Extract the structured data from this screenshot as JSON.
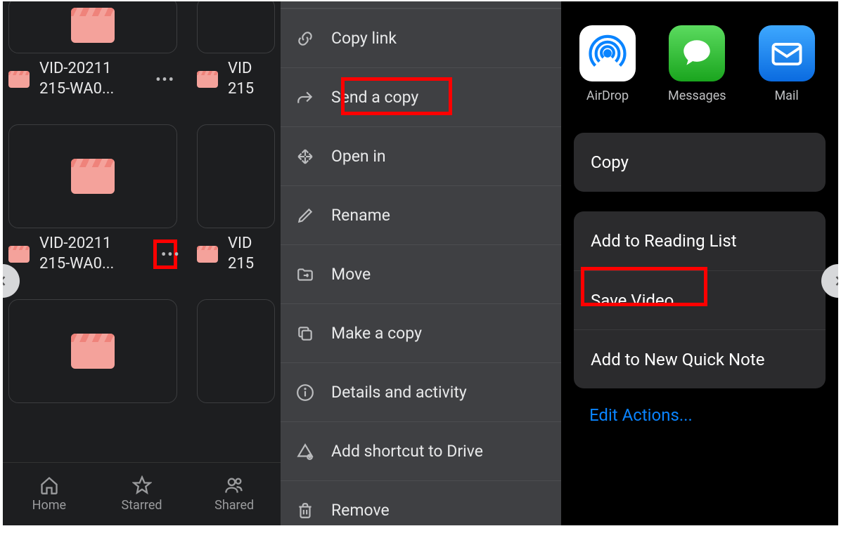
{
  "panel1": {
    "files": [
      {
        "name_line1": "VID-20211",
        "name_line2": "215-WA0..."
      },
      {
        "name_line1": "VID",
        "name_line2": "215"
      },
      {
        "name_line1": "VID-20211",
        "name_line2": "215-WA0..."
      },
      {
        "name_line1": "VID",
        "name_line2": "215"
      }
    ],
    "tabs": {
      "home": "Home",
      "starred": "Starred",
      "shared": "Shared"
    }
  },
  "panel2": {
    "items": {
      "copy_link": "Copy link",
      "send_copy": "Send a copy",
      "open_in": "Open in",
      "rename": "Rename",
      "move": "Move",
      "make_copy": "Make a copy",
      "details": "Details and activity",
      "add_shortcut": "Add shortcut to Drive",
      "remove": "Remove"
    }
  },
  "panel3": {
    "share": {
      "airdrop": "AirDrop",
      "messages": "Messages",
      "mail": "Mail"
    },
    "actions": {
      "copy": "Copy",
      "reading_list": "Add to Reading List",
      "save_video": "Save Video",
      "quick_note": "Add to New Quick Note"
    },
    "edit_actions": "Edit Actions..."
  }
}
